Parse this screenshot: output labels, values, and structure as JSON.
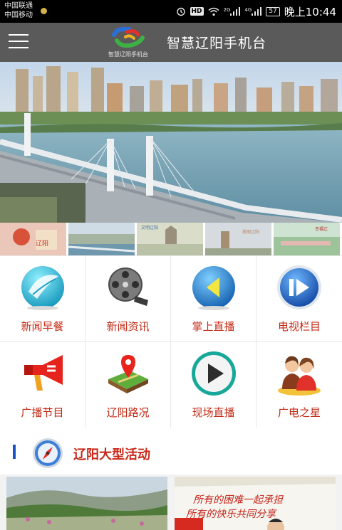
{
  "status_bar": {
    "carrier_1": "中国联通",
    "carrier_2": "中国移动",
    "hd": "HD",
    "net_2g": "2G",
    "net_4g": "4G",
    "battery": "57",
    "time": "晚上10:44",
    "icons": [
      "alarm-icon",
      "wifi-icon",
      "signal-icon",
      "battery-icon"
    ]
  },
  "header": {
    "title": "智慧辽阳手机台",
    "logo_text": "智慧辽阳手机台",
    "menu_icon": "hamburger-menu-icon"
  },
  "thumbs": [
    {
      "label": "辽阳"
    },
    {
      "label": "文明辽阳"
    },
    {
      "label": ""
    },
    {
      "label": "美丽辽阳"
    },
    {
      "label": "幸福辽"
    }
  ],
  "grid": {
    "items": [
      {
        "label": "新闻早餐",
        "icon": "news-leaf-icon"
      },
      {
        "label": "新闻资讯",
        "icon": "film-reel-icon"
      },
      {
        "label": "掌上直播",
        "icon": "back-arrow-globe-icon"
      },
      {
        "label": "电视栏目",
        "icon": "play-pause-icon"
      },
      {
        "label": "广播节目",
        "icon": "megaphone-icon"
      },
      {
        "label": "辽阳路况",
        "icon": "map-pin-icon"
      },
      {
        "label": "现场直播",
        "icon": "play-button-icon"
      },
      {
        "label": "广电之星",
        "icon": "people-icon"
      }
    ]
  },
  "section": {
    "title": "辽阳大型活动",
    "icon": "compass-icon"
  },
  "cards": [
    {
      "text": ""
    },
    {
      "line_1": "所有的困难一起承担",
      "line_2": "所有的快乐共同分享"
    }
  ],
  "colors": {
    "accent_red": "#c9281a",
    "header_gray": "#5a5a5a",
    "section_blue": "#1a54c4"
  }
}
